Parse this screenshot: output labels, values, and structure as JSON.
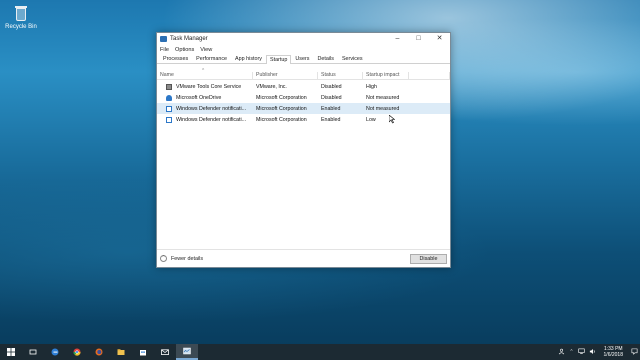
{
  "desktop": {
    "icons": [
      {
        "label": "Recycle Bin",
        "icon": "recycle-bin-icon"
      }
    ]
  },
  "window": {
    "title": "Task Manager",
    "controls": {
      "minimize": "–",
      "maximize": "□",
      "close": "✕"
    },
    "menu": [
      "File",
      "Options",
      "View"
    ],
    "tabs": [
      "Processes",
      "Performance",
      "App history",
      "Startup",
      "Users",
      "Details",
      "Services"
    ],
    "active_tab": "Startup",
    "columns": [
      "Name",
      "Publisher",
      "Status",
      "Startup impact"
    ],
    "rows": [
      {
        "name": "VMware Tools Core Service",
        "publisher": "VMware, Inc.",
        "status": "Disabled",
        "impact": "High",
        "icon": "vmware-icon"
      },
      {
        "name": "Microsoft OneDrive",
        "publisher": "Microsoft Corporation",
        "status": "Disabled",
        "impact": "Not measured",
        "icon": "onedrive-icon"
      },
      {
        "name": "Windows Defender notificati...",
        "publisher": "Microsoft Corporation",
        "status": "Enabled",
        "impact": "Not measured",
        "icon": "windows-defender-icon"
      },
      {
        "name": "Windows Defender notificati...",
        "publisher": "Microsoft Corporation",
        "status": "Enabled",
        "impact": "Low",
        "icon": "windows-defender-icon"
      }
    ],
    "footer": {
      "fewer_details": "Fewer details",
      "disable_button": "Disable"
    }
  },
  "taskbar": {
    "items": [
      "start-icon",
      "task-view-icon",
      "edge-icon",
      "chrome-icon",
      "firefox-icon",
      "file-explorer-icon",
      "store-icon",
      "mail-icon",
      "task-manager-icon"
    ],
    "active_item": "task-manager-icon",
    "clock": {
      "time": "1:33 PM",
      "date": "1/6/2018"
    }
  }
}
